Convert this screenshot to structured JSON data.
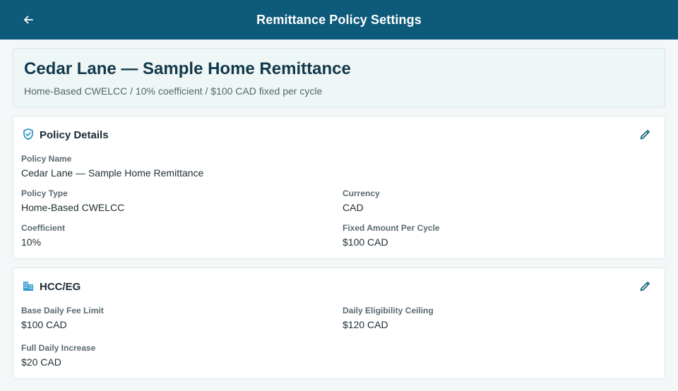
{
  "app_bar": {
    "title": "Remittance Policy Settings",
    "back_icon": "arrow-left-icon"
  },
  "header": {
    "title": "Cedar Lane — Sample Home Remittance",
    "subtitle": "Home-Based CWELCC / 10% coefficient / $100 CAD fixed per cycle"
  },
  "policy_details": {
    "title": "Policy Details",
    "icon": "shield-check-icon",
    "edit_icon": "pencil-icon",
    "policy_name": {
      "label": "Policy Name",
      "value": "Cedar Lane — Sample Home Remittance"
    },
    "policy_type": {
      "label": "Policy Type",
      "value": "Home-Based CWELCC"
    },
    "currency": {
      "label": "Currency",
      "value": "CAD"
    },
    "coefficient": {
      "label": "Coefficient",
      "value": "10%"
    },
    "fixed_amount": {
      "label": "Fixed Amount Per Cycle",
      "value": "$100 CAD"
    }
  },
  "hcc_eg": {
    "title": "HCC/EG",
    "icon": "building-icon",
    "edit_icon": "pencil-icon",
    "base_daily_fee_limit": {
      "label": "Base Daily Fee Limit",
      "value": "$100 CAD"
    },
    "daily_eligibility_ceiling": {
      "label": "Daily Eligibility Ceiling",
      "value": "$120 CAD"
    },
    "full_daily_increase": {
      "label": "Full Daily Increase",
      "value": "$20 CAD"
    }
  },
  "colors": {
    "app_bar": "#0e5a7a",
    "accent": "#0e7fb0",
    "background": "#f3f7f8"
  }
}
